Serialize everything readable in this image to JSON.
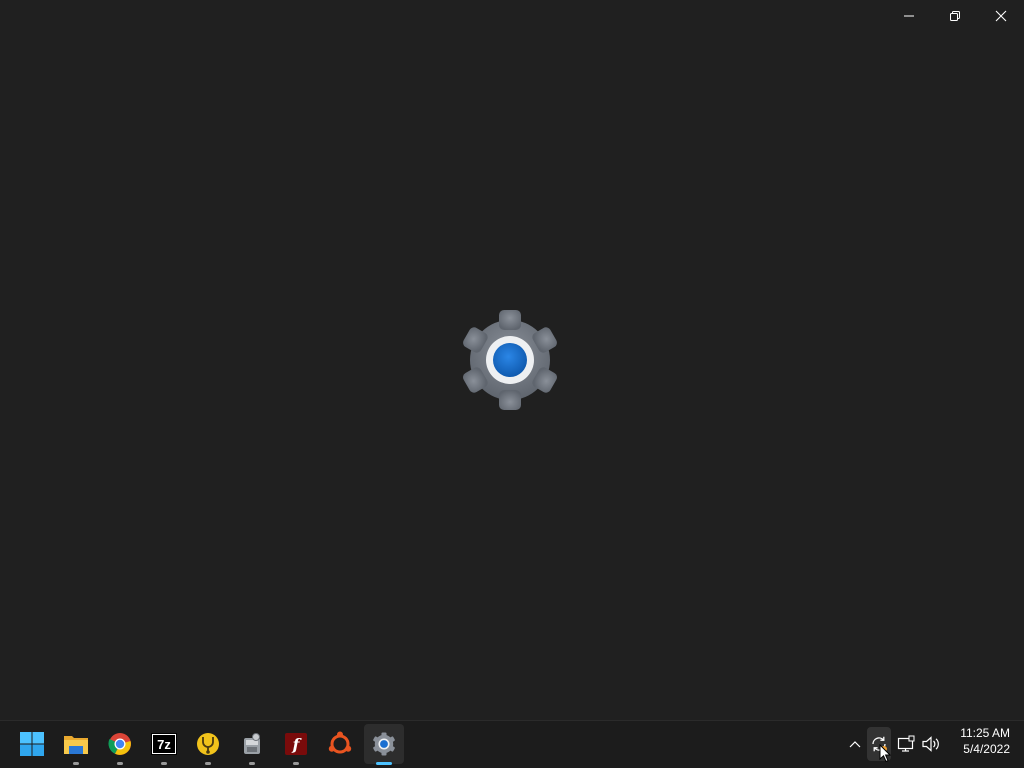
{
  "window": {
    "caption_buttons": [
      {
        "name": "minimize",
        "icon": "minimize-icon"
      },
      {
        "name": "restore",
        "icon": "restore-icon"
      },
      {
        "name": "close",
        "icon": "close-icon"
      }
    ]
  },
  "splash": {
    "icon": "settings-gear-icon",
    "accent": "#1a6fd1"
  },
  "taskbar": {
    "apps": [
      {
        "name": "Start",
        "icon": "windows-start-icon",
        "running": false
      },
      {
        "name": "File Explorer",
        "icon": "folder-icon",
        "running": true
      },
      {
        "name": "Google Chrome",
        "icon": "chrome-icon",
        "running": true
      },
      {
        "name": "7-Zip",
        "icon": "7zip-icon",
        "label": "7z",
        "running": true
      },
      {
        "name": "Stethoscope app",
        "icon": "stethoscope-icon",
        "running": true
      },
      {
        "name": "Utility app",
        "icon": "utility-icon",
        "running": true
      },
      {
        "name": "Adobe Flash",
        "icon": "flash-icon",
        "label": "f",
        "running": true
      },
      {
        "name": "Ubuntu",
        "icon": "ubuntu-icon",
        "running": false
      },
      {
        "name": "Settings",
        "icon": "settings-gear-icon",
        "running": true,
        "active": true
      }
    ],
    "tray": [
      {
        "name": "show hidden icons",
        "icon": "chevron-up-icon"
      },
      {
        "name": "sync",
        "icon": "sync-icon"
      },
      {
        "name": "network",
        "icon": "network-icon"
      },
      {
        "name": "volume",
        "icon": "volume-icon"
      }
    ],
    "clock": {
      "time": "11:25 AM",
      "date": "5/4/2022"
    }
  },
  "colors": {
    "background": "#202020",
    "taskbar": "#1c1c1c",
    "active_indicator": "#4cc2ff"
  }
}
